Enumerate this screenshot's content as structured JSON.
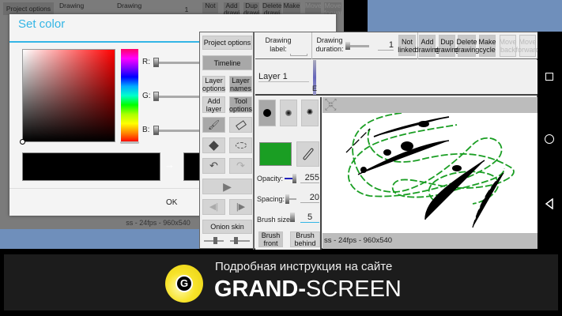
{
  "background_app": {
    "project_options": "Project options",
    "drawing_label": "Drawing",
    "drawing_duration": "Drawing",
    "duration_value": "1",
    "not_linked": "Not",
    "add_drawing": "Add drawi",
    "dup_drawing": "Dup drawi",
    "delete_drawing": "Delete drawi",
    "make_cycle": "Make",
    "move_back": "Move",
    "move_forward": "Move forward",
    "status": "ss - 24fps - 960x540"
  },
  "dialog": {
    "title": "Set color",
    "r_label": "R:",
    "g_label": "G:",
    "b_label": "B:",
    "ok": "OK",
    "arrow": "→",
    "accent": "#33b5e5"
  },
  "app": {
    "sidebar": {
      "project_options": "Project options",
      "timeline": "Timeline",
      "layer_options": "Layer options",
      "layer_names": "Layer names",
      "add_layer": "Add layer",
      "tool_options": "Tool options",
      "onion_skin": "Onion skin"
    },
    "toolbar": {
      "drawing_label": "Drawing label:",
      "drawing_duration": "Drawing duration:",
      "duration_value": "1",
      "not_linked": "Not linked",
      "add_drawing": "Add drawing",
      "dup_drawing": "Dup drawing",
      "delete_drawing": "Delete drawing",
      "make_cycle": "Make cycle",
      "move_back": "Move back",
      "move_forward": "Move forward"
    },
    "timeline": {
      "layer_name": "Layer 1",
      "marker": "E"
    },
    "tool_panel": {
      "opacity_label": "Opacity:",
      "opacity_value": "255",
      "spacing_label": "Spacing:",
      "spacing_value": "20",
      "brush_size_label": "Brush size:",
      "brush_size_value": "5",
      "brush_front": "Brush front",
      "brush_behind": "Brush behind",
      "brush_color": "#1a9e23"
    },
    "canvas": {
      "status": "ss - 24fps - 960x540"
    }
  },
  "banner": {
    "subtitle": "Подробная инструкция на сайте",
    "brand_bold": "GRAND-",
    "brand_light": "SCREEN",
    "logo_letter": "G"
  }
}
